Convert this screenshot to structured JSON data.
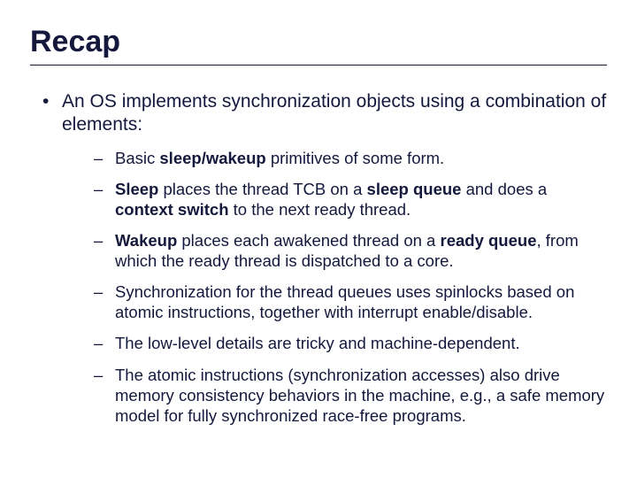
{
  "title": "Recap",
  "main": {
    "lead": "An OS implements synchronization objects using a combination of elements:",
    "items": {
      "a": {
        "pre": "Basic ",
        "b1": "sleep/wakeup",
        "post": " primitives of some form."
      },
      "b": {
        "b1": "Sleep",
        "t1": " places the thread TCB on a ",
        "b2": "sleep queue",
        "t2": " and does a ",
        "b3": "context switch",
        "t3": " to the next ready thread."
      },
      "c": {
        "b1": "Wakeup",
        "t1": " places each awakened thread on a ",
        "b2": "ready queue",
        "t2": ", from which the ready thread is dispatched to a core."
      },
      "d": "Synchronization for the thread queues uses spinlocks based on atomic instructions, together with interrupt enable/disable.",
      "e": "The low-level details are tricky and machine-dependent.",
      "f": "The atomic instructions (synchronization accesses) also drive memory consistency behaviors in the machine, e.g., a safe memory model for fully synchronized race-free programs."
    }
  },
  "markers": {
    "dot": "•",
    "dash": "–"
  }
}
